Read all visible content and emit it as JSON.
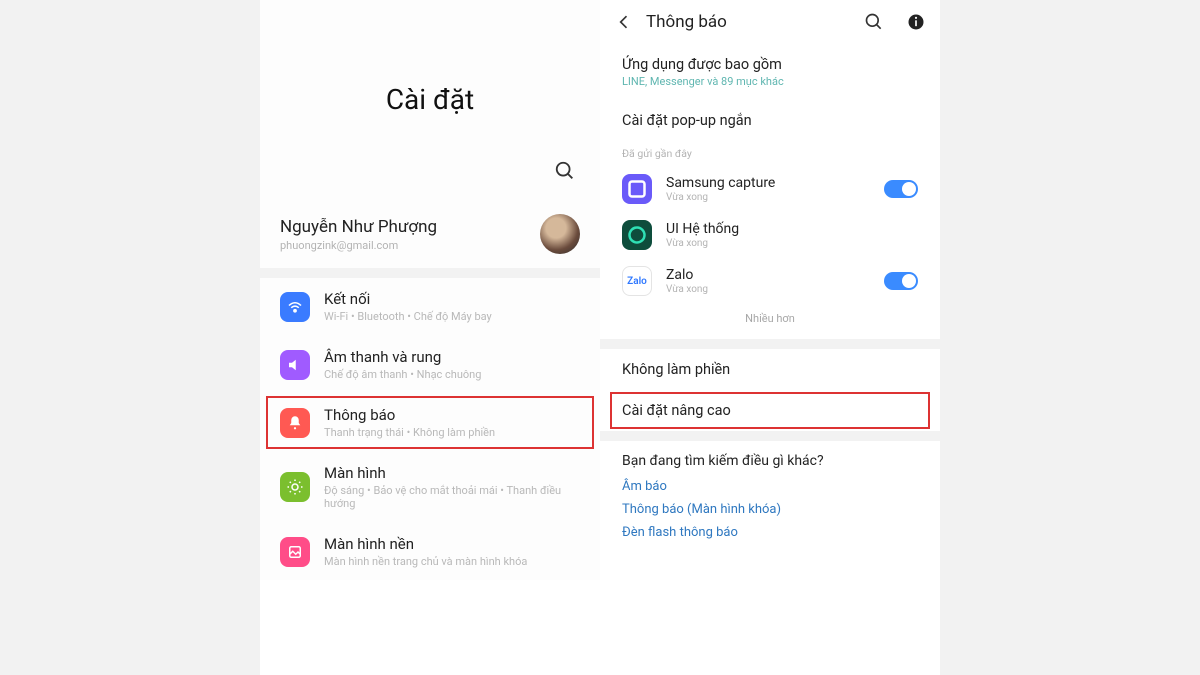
{
  "left": {
    "title": "Cài đặt",
    "profile": {
      "name": "Nguyễn Như Phượng",
      "email": "phuongzink@gmail.com"
    },
    "items": [
      {
        "title": "Kết nối",
        "sub": "Wi-Fi • Bluetooth • Chế độ Máy bay",
        "icon": "wifi",
        "color": "blue"
      },
      {
        "title": "Âm thanh và rung",
        "sub": "Chế độ âm thanh • Nhạc chuông",
        "icon": "sound",
        "color": "purple"
      },
      {
        "title": "Thông báo",
        "sub": "Thanh trạng thái • Không làm phiền",
        "icon": "bell",
        "color": "red",
        "highlight": true
      },
      {
        "title": "Màn hình",
        "sub": "Độ sáng • Bảo vệ cho mắt thoải mái • Thanh điều hướng",
        "icon": "display",
        "color": "green"
      },
      {
        "title": "Màn hình nền",
        "sub": "Màn hình nền trang chủ và màn hình khóa",
        "icon": "wallpaper",
        "color": "pink"
      }
    ]
  },
  "right": {
    "header_title": "Thông báo",
    "included_apps": {
      "title": "Ứng dụng được bao gồm",
      "sub": "LINE, Messenger và 89 mục khác"
    },
    "popup": {
      "title": "Cài đặt pop-up ngắn"
    },
    "recent_label": "Đã gửi gần đây",
    "apps": [
      {
        "name": "Samsung capture",
        "sub": "Vừa xong",
        "toggle": "on",
        "color": "#6a5af9"
      },
      {
        "name": "UI Hệ thống",
        "sub": "Vừa xong",
        "toggle": "none",
        "color": "#0e4d3c"
      },
      {
        "name": "Zalo",
        "sub": "Vừa xong",
        "toggle": "on",
        "color": "#ffffff",
        "text": "Zalo"
      }
    ],
    "more": "Nhiều hơn",
    "dnd": "Không làm phiền",
    "advanced": "Cài đặt nâng cao",
    "related": {
      "title": "Bạn đang tìm kiếm điều gì khác?",
      "links": [
        "Âm báo",
        "Thông báo (Màn hình khóa)",
        "Đèn flash thông báo"
      ]
    }
  }
}
